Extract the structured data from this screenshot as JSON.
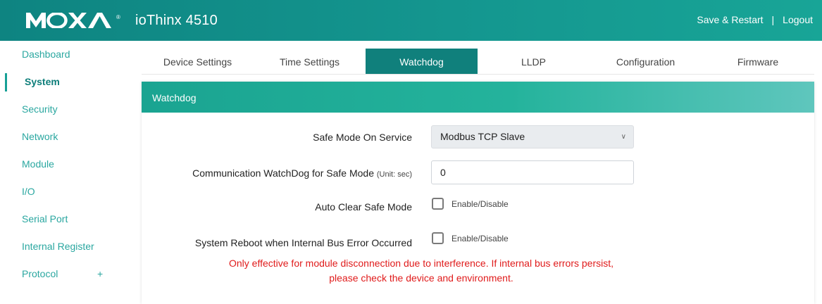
{
  "header": {
    "brand": "MOXA",
    "brand_reg": "®",
    "product": "ioThinx 4510",
    "save_restart": "Save & Restart",
    "separator": "|",
    "logout": "Logout"
  },
  "sidebar": {
    "items": [
      {
        "label": "Dashboard"
      },
      {
        "label": "System",
        "active": true
      },
      {
        "label": "Security"
      },
      {
        "label": "Network"
      },
      {
        "label": "Module"
      },
      {
        "label": "I/O"
      },
      {
        "label": "Serial Port"
      },
      {
        "label": "Internal Register"
      },
      {
        "label": "Protocol",
        "expand": "+"
      }
    ]
  },
  "tabs": [
    {
      "label": "Device Settings"
    },
    {
      "label": "Time Settings"
    },
    {
      "label": "Watchdog",
      "active": true
    },
    {
      "label": "LLDP"
    },
    {
      "label": "Configuration"
    },
    {
      "label": "Firmware"
    }
  ],
  "panel": {
    "title": "Watchdog",
    "safe_mode": {
      "label": "Safe Mode On Service",
      "value": "Modbus TCP Slave",
      "chevron": "∨"
    },
    "comm_watchdog": {
      "label": "Communication WatchDog for Safe Mode",
      "unit": "(Unit: sec)",
      "value": "0"
    },
    "auto_clear": {
      "label": "Auto Clear Safe Mode",
      "check_label": "Enable/Disable",
      "checked": false
    },
    "reboot": {
      "label": "System Reboot when Internal Bus Error Occurred",
      "check_label": "Enable/Disable",
      "checked": false
    },
    "warning_line1": "Only effective for module disconnection due to interference. If internal bus errors persist,",
    "warning_line2": "please check the device and environment."
  },
  "colors": {
    "header": "#14968f",
    "accent": "#10807c",
    "sidebar_text": "#2aa7a0",
    "warning": "#e01b1b"
  }
}
